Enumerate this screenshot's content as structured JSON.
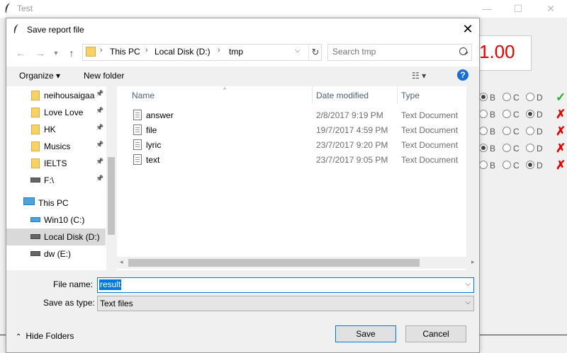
{
  "background_app": {
    "title": "Test",
    "score": "1.00",
    "colors": {
      "score": "#e00000",
      "correct": "#22b322",
      "wrong": "#e00000"
    },
    "questions": [
      {
        "selected": "B",
        "result": "correct",
        "mark": "✓"
      },
      {
        "selected": "D",
        "result": "wrong",
        "mark": "✗"
      },
      {
        "selected": "",
        "result": "wrong",
        "mark": "✗"
      },
      {
        "selected": "B",
        "result": "wrong",
        "mark": "✗"
      },
      {
        "selected": "D",
        "result": "wrong",
        "mark": "✗"
      }
    ],
    "options": [
      "B",
      "C",
      "D"
    ]
  },
  "dialog": {
    "title": "Save report file",
    "address": [
      "This PC",
      "Local Disk (D:)",
      "tmp"
    ],
    "search_placeholder": "Search tmp",
    "toolbar": {
      "organize": "Organize ▾",
      "new_folder": "New folder",
      "help": "?"
    },
    "nav": {
      "quick_access": [
        "neihousaigaa",
        "Love Love",
        "HK",
        "Musics",
        "IELTS",
        "F:\\"
      ],
      "this_pc": "This PC",
      "drives": [
        "Win10 (C:)",
        "Local Disk (D:)",
        "dw (E:)"
      ]
    },
    "columns": {
      "name": "Name",
      "date": "Date modified",
      "type": "Type"
    },
    "files": [
      {
        "name": "answer",
        "date": "2/8/2017 9:19 PM",
        "type": "Text Document"
      },
      {
        "name": "file",
        "date": "19/7/2017 4:59 PM",
        "type": "Text Document"
      },
      {
        "name": "lyric",
        "date": "23/7/2017 9:20 PM",
        "type": "Text Document"
      },
      {
        "name": "text",
        "date": "23/7/2017 9:05 PM",
        "type": "Text Document"
      }
    ],
    "file_name_label": "File name:",
    "file_name_value": "result",
    "save_type_label": "Save as type:",
    "save_type_value": "Text files",
    "hide_folders": "Hide Folders",
    "save_button": "Save",
    "cancel_button": "Cancel",
    "accent": "#0078d7"
  }
}
